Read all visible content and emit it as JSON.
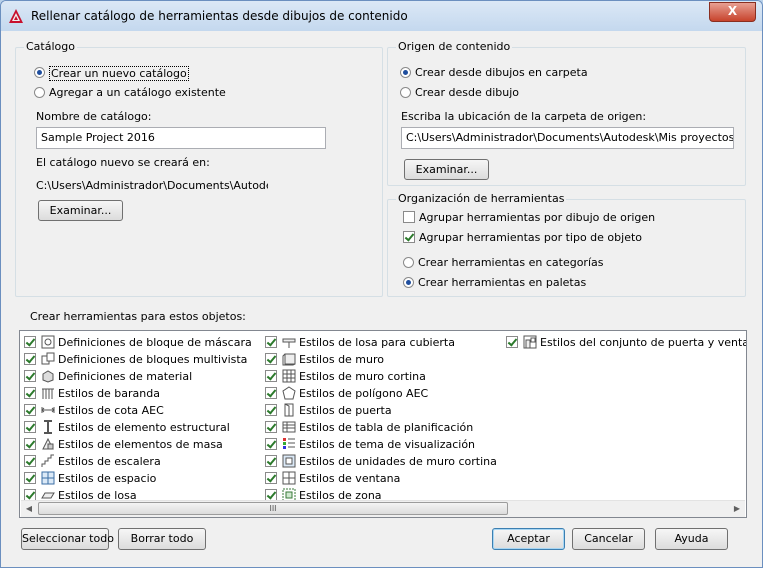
{
  "window": {
    "title": "Rellenar catálogo de herramientas desde dibujos de contenido",
    "close_label": "X"
  },
  "catalog_group": {
    "legend": "Catálogo",
    "option_new": "Crear un nuevo catálogo",
    "option_existing": "Agregar a un catálogo existente",
    "name_label": "Nombre de catálogo:",
    "name_value": "Sample Project 2016",
    "created_in_label": "El catálogo nuevo se creará en:",
    "created_in_path": "C:\\Users\\Administrador\\Documents\\Autodesk\\M",
    "browse_label": "Examinar..."
  },
  "source_group": {
    "legend": "Origen de contenido",
    "option_folder": "Crear desde dibujos en carpeta",
    "option_drawing": "Crear desde dibujo",
    "location_label": "Escriba la ubicación de la carpeta de origen:",
    "location_value": "C:\\Users\\Administrador\\Documents\\Autodesk\\Mis proyectos\\Sample",
    "browse_label": "Examinar..."
  },
  "org_group": {
    "legend": "Organización de herramientas",
    "group_by_drawing": "Agrupar herramientas por dibujo de origen",
    "group_by_type": "Agrupar herramientas por tipo de objeto",
    "in_categories": "Crear herramientas en categorías",
    "in_palettes": "Crear herramientas en paletas"
  },
  "objects": {
    "label": "Crear herramientas para estos objetos:",
    "columns": [
      [
        {
          "label": "Definiciones de bloque de máscara",
          "icon": "mask-block-icon"
        },
        {
          "label": "Definiciones de bloques multivista",
          "icon": "multiview-block-icon"
        },
        {
          "label": "Definiciones de material",
          "icon": "material-icon"
        },
        {
          "label": "Estilos de baranda",
          "icon": "railing-icon"
        },
        {
          "label": "Estilos de cota AEC",
          "icon": "aec-dimension-icon"
        },
        {
          "label": "Estilos de elemento estructural",
          "icon": "structural-member-icon"
        },
        {
          "label": "Estilos de elementos de masa",
          "icon": "mass-element-icon"
        },
        {
          "label": "Estilos de escalera",
          "icon": "stair-icon"
        },
        {
          "label": "Estilos de espacio",
          "icon": "space-icon"
        },
        {
          "label": "Estilos de losa",
          "icon": "slab-icon"
        }
      ],
      [
        {
          "label": "Estilos de losa para cubierta",
          "icon": "roof-slab-icon"
        },
        {
          "label": "Estilos de muro",
          "icon": "wall-icon"
        },
        {
          "label": "Estilos de muro cortina",
          "icon": "curtain-wall-icon"
        },
        {
          "label": "Estilos de polígono AEC",
          "icon": "aec-polygon-icon"
        },
        {
          "label": "Estilos de puerta",
          "icon": "door-icon"
        },
        {
          "label": "Estilos de tabla de planificación",
          "icon": "schedule-table-icon"
        },
        {
          "label": "Estilos de tema de visualización",
          "icon": "display-theme-icon"
        },
        {
          "label": "Estilos de unidades de muro cortina",
          "icon": "curtain-wall-unit-icon"
        },
        {
          "label": "Estilos de ventana",
          "icon": "window-icon"
        },
        {
          "label": "Estilos de zona",
          "icon": "zone-icon"
        }
      ],
      [
        {
          "label": "Estilos del conjunto de puerta y ventana",
          "icon": "door-window-assembly-icon"
        }
      ]
    ],
    "scroll_grip": "III"
  },
  "buttons": {
    "select_all": "Seleccionar todo",
    "clear_all": "Borrar todo",
    "accept": "Aceptar",
    "cancel": "Cancelar",
    "help": "Ayuda"
  },
  "colors": {
    "accent": "#1f4e9e",
    "check": "#2c7a2c",
    "autodesk_red": "#c8102e"
  }
}
